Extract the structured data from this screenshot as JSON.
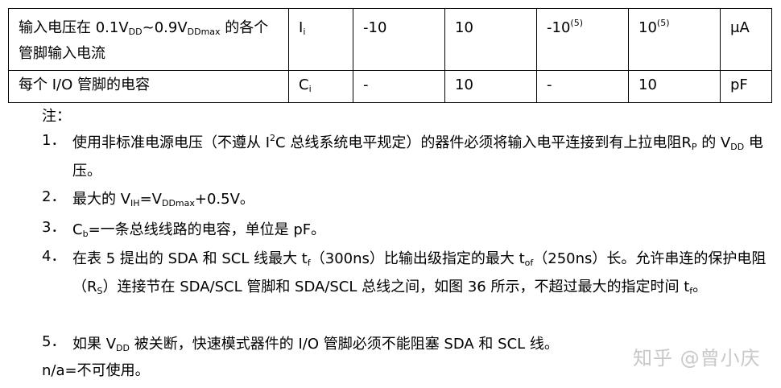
{
  "table": {
    "row1": {
      "desc_pre": "输入电压在 0.1V",
      "desc_sub1": "DD",
      "desc_mid": "~0.9V",
      "desc_sub2": "DDmax",
      "desc_post": " 的各个管脚输入电流",
      "symbol": "I",
      "symbol_sub": "i",
      "std_min": "-10",
      "std_max": "10",
      "fast_min": "-10",
      "fast_min_sup": "(5)",
      "fast_max": "10",
      "fast_max_sup": "(5)",
      "unit": "μA"
    },
    "row2": {
      "desc": "每个 I/O 管脚的电容",
      "symbol": "C",
      "symbol_sub": "i",
      "std_min": "-",
      "std_max": "10",
      "fast_min": "-",
      "fast_max": "10",
      "unit": "pF"
    }
  },
  "notes": {
    "heading": "注：",
    "n1": {
      "num": "1．",
      "a": "使用非标准电源电压（不遵从 I",
      "sup": "2",
      "b": "C 总线系统电平规定）的器件必须将输入电平连接到有上拉电阻R",
      "sub1": "P",
      "c": " 的 V",
      "sub2": "DD",
      "d": " 电压。"
    },
    "n2": {
      "num": "2．",
      "a": "最大的 V",
      "sub1": "IH",
      "b": "=V",
      "sub2": "DDmax",
      "c": "+0.5V。"
    },
    "n3": {
      "num": "3．",
      "a": "C",
      "sub1": "b",
      "b": "=一条总线线路的电容，单位是 pF。"
    },
    "n4": {
      "num": "4．",
      "a": "在表 5 提出的 SDA 和 SCL 线最大 t",
      "sub1": "f",
      "b": "（300ns）比输出级指定的最大 t",
      "sub2": "of",
      "c": "（250ns）长。允许串连的保护电阻（R",
      "sub3": "S",
      "d": "）连接节在 SDA/SCL 管脚和 SDA/SCL 总线之间，如图 36 所示，不超过最大的指定时间 t",
      "sub4": "f",
      "e": "。"
    },
    "n5": {
      "num": "5．",
      "a": "如果 V",
      "sub1": "DD",
      "b": " 被关断，快速模式器件的 I/O 管脚必须不能阻塞 SDA 和 SCL 线。"
    },
    "na": "n/a=不可使用。"
  },
  "watermark": "知乎 @曾小庆"
}
